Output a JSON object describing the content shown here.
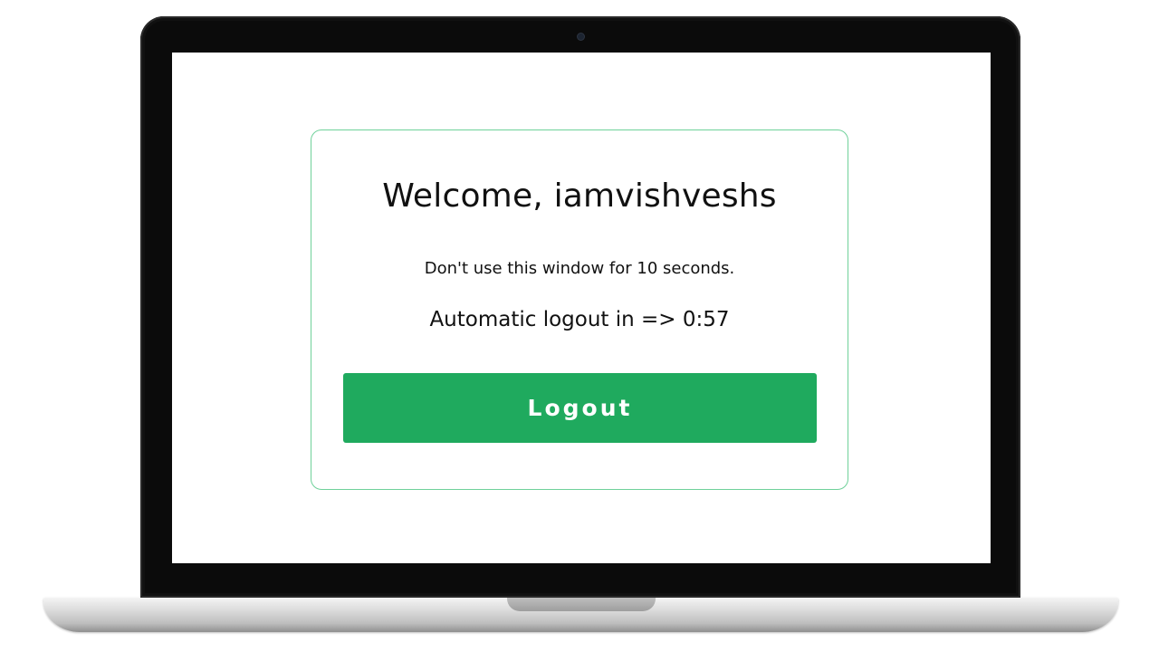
{
  "page": {
    "welcome_title": "Welcome, iamvishveshs",
    "idle_notice": "Don't use this window for 10 seconds.",
    "logout_countdown": "Automatic logout in => 0:57",
    "logout_button_label": "Logout"
  },
  "colors": {
    "accent": "#1faa5e",
    "card_border": "#6fd19a",
    "text": "#111111",
    "bezel": "#0b0b0b"
  }
}
